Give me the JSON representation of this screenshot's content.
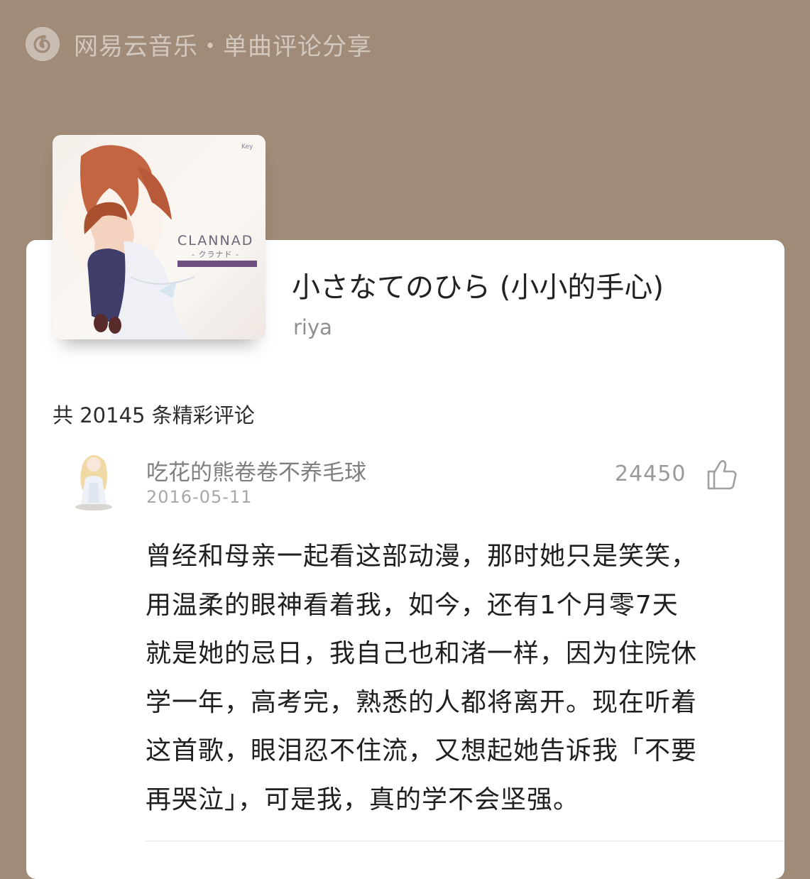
{
  "header": {
    "title": "网易云音乐・单曲评论分享"
  },
  "song": {
    "cover_brand": "CLANNAD",
    "cover_subtitle": "- クラナド -",
    "title": "小さなてのひら (小小的手心)",
    "artist": "riya"
  },
  "comments_summary": "共 20145 条精彩评论",
  "comment": {
    "username": "吃花的熊卷卷不养毛球",
    "date": "2016-05-11",
    "likes": "24450",
    "lines": [
      "曾经和母亲一起看这部动漫，那时她只是笑笑，",
      "用温柔的眼神看着我，如今，还有1个月零7天",
      "就是她的忌日，我自己也和渚一样，因为住院休",
      "学一年，高考完，熟悉的人都将离开。现在听着",
      "这首歌，眼泪忍不住流，又想起她告诉我「不要",
      "再哭泣」，可是我，真的学不会坚强。"
    ]
  },
  "colors": {
    "background": "#a08b78",
    "card": "#ffffff",
    "text_primary": "#1f1f1f",
    "text_secondary": "#8f8f8f"
  },
  "icons": {
    "logo": "netease-music-logo-icon",
    "like": "thumbs-up-icon"
  }
}
